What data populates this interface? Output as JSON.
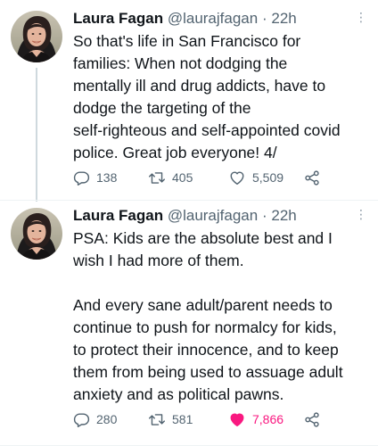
{
  "tweets": [
    {
      "name": "Laura Fagan",
      "handle": "@laurajfagan",
      "separator": "·",
      "time": "22h",
      "text": "So that's life in San Francisco for\nfamilies: When not dodging the\nmentally ill and drug addicts, have to\ndodge the targeting of the\nself-righteous and self-appointed covid\npolice. Great job everyone! 4/",
      "replies": "138",
      "retweets": "405",
      "likes": "5,509",
      "liked": false
    },
    {
      "name": "Laura Fagan",
      "handle": "@laurajfagan",
      "separator": "·",
      "time": "22h",
      "text": "PSA: Kids are the absolute best and I\nwish I had more of them.\n\nAnd every sane adult/parent needs to\ncontinue to push for normalcy for kids,\nto protect their innocence, and to keep\nthem from being used to assuage adult\nanxiety and as political pawns.",
      "replies": "280",
      "retweets": "581",
      "likes": "7,866",
      "liked": true
    }
  ],
  "icons": {
    "reply": "reply-icon",
    "retweet": "retweet-icon",
    "like": "heart-icon",
    "share": "share-icon",
    "more": "more-icon"
  },
  "colors": {
    "text": "#0f1419",
    "secondary": "#536471",
    "like_active": "#f91880",
    "thread_line": "#cfd9de"
  }
}
